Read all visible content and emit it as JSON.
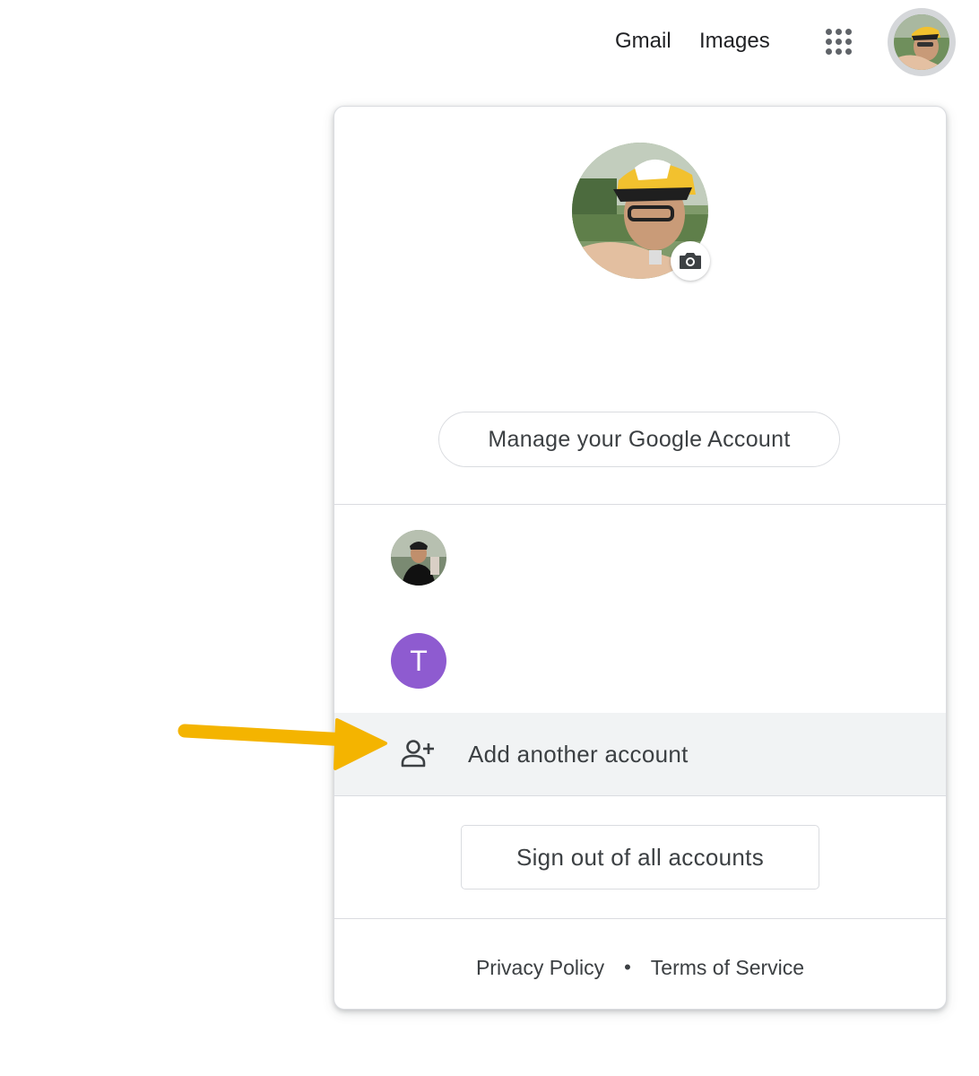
{
  "topbar": {
    "gmail_label": "Gmail",
    "images_label": "Images",
    "apps_icon": "apps-grid-icon"
  },
  "account_panel": {
    "camera_icon": "camera-icon",
    "manage_label": "Manage your Google Account",
    "accounts": [
      {
        "avatar": "photo"
      },
      {
        "avatar_letter": "T",
        "avatar_color": "#8e5bd0"
      }
    ],
    "add_account_label": "Add another account",
    "add_account_icon": "person-add-icon",
    "signout_label": "Sign out of all accounts",
    "footer": {
      "privacy_label": "Privacy Policy",
      "separator": "•",
      "terms_label": "Terms of Service"
    }
  },
  "annotation": {
    "arrow_color": "#f4b400",
    "arrow_icon": "arrow-right-icon"
  }
}
